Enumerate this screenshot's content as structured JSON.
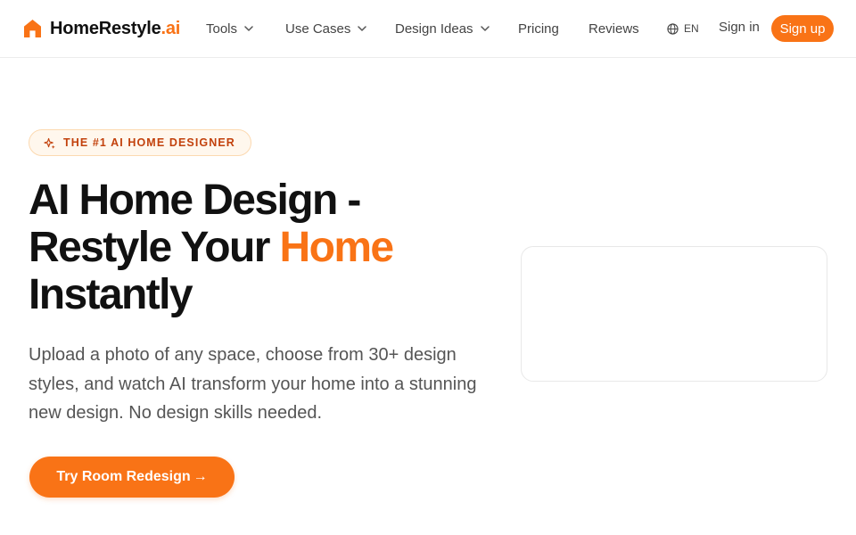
{
  "brand": {
    "name": "HomeRestyle",
    "suffix": ".ai",
    "accent_color": "#f97316",
    "logo_icon": "house-icon"
  },
  "nav": {
    "items": [
      {
        "label": "Tools",
        "has_dropdown": true
      },
      {
        "label": "Use Cases",
        "has_dropdown": true
      },
      {
        "label": "Design Ideas",
        "has_dropdown": true
      },
      {
        "label": "Pricing",
        "has_dropdown": false
      },
      {
        "label": "Reviews",
        "has_dropdown": false
      }
    ],
    "language": {
      "icon": "globe-icon",
      "code": "EN"
    },
    "signin_label": "Sign in",
    "signup_label": "Sign up"
  },
  "hero": {
    "badge": {
      "icon": "sparkles-icon",
      "label": "THE #1 AI HOME DESIGNER"
    },
    "headline": {
      "line1": "AI Home Design -",
      "line2_pre": "Restyle Your ",
      "line2_accent": "Home",
      "line3": "Instantly"
    },
    "subtitle": "Upload a photo of any space, choose from 30+ design styles, and watch AI transform your home into a stunning new design. No design skills needed.",
    "cta": {
      "label": "Try Room Redesign",
      "icon": "arrow-right-icon",
      "arrow": "→"
    }
  }
}
